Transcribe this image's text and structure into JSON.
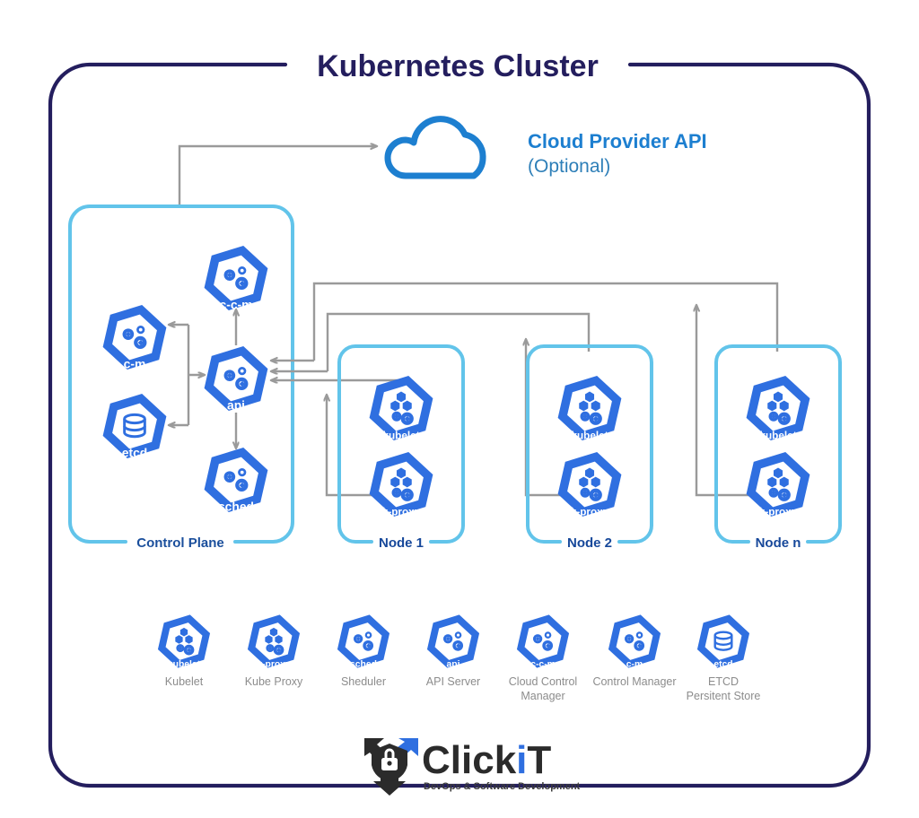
{
  "diagram": {
    "title": "Kubernetes Cluster",
    "colors": {
      "outer_border": "#241e5e",
      "group_border": "#62c4ea",
      "k8s_blue": "#2f6fe0",
      "connector_gray": "#9a9a9a",
      "cloud_blue": "#1d7fd0",
      "legend_text": "#8c8c8c",
      "label_blue": "#17489a",
      "background": "#ffffff"
    }
  },
  "cloud": {
    "icon": "cloud-icon",
    "title": "Cloud Provider API",
    "subtitle": "(Optional)"
  },
  "control_plane": {
    "label": "Control Plane",
    "components": [
      {
        "id": "ccm",
        "caption": "c-c-m",
        "icon": "gears-icon"
      },
      {
        "id": "cm",
        "caption": "c-m",
        "icon": "gears-icon"
      },
      {
        "id": "api",
        "caption": "api",
        "icon": "gears-icon"
      },
      {
        "id": "etcd",
        "caption": "etcd",
        "icon": "database-icon"
      },
      {
        "id": "sched",
        "caption": "sched",
        "icon": "gears-icon"
      }
    ]
  },
  "nodes": [
    {
      "label": "Node 1",
      "components": [
        {
          "id": "kubelet",
          "caption": "kubelet",
          "icon": "cubes-gears-icon"
        },
        {
          "id": "kproxy",
          "caption": "k-proxy",
          "icon": "cubes-gears-icon"
        }
      ]
    },
    {
      "label": "Node 2",
      "components": [
        {
          "id": "kubelet",
          "caption": "kubelet",
          "icon": "cubes-gears-icon"
        },
        {
          "id": "kproxy",
          "caption": "k-proxy",
          "icon": "cubes-gears-icon"
        }
      ]
    },
    {
      "label": "Node n",
      "components": [
        {
          "id": "kubelet",
          "caption": "kubelet",
          "icon": "cubes-gears-icon"
        },
        {
          "id": "kproxy",
          "caption": "k-proxy",
          "icon": "cubes-gears-icon"
        }
      ]
    }
  ],
  "legend": [
    {
      "caption": "kubelet",
      "label_line1": "Kubelet",
      "label_line2": "",
      "icon": "cubes-gears-icon"
    },
    {
      "caption": "k-proxy",
      "label_line1": "Kube Proxy",
      "label_line2": "",
      "icon": "cubes-gears-icon"
    },
    {
      "caption": "sched",
      "label_line1": "Sheduler",
      "label_line2": "",
      "icon": "gears-icon"
    },
    {
      "caption": "api",
      "label_line1": "API Server",
      "label_line2": "",
      "icon": "gears-icon"
    },
    {
      "caption": "c-c-m",
      "label_line1": "Cloud Control",
      "label_line2": "Manager",
      "icon": "gears-icon"
    },
    {
      "caption": "c-m",
      "label_line1": "Control Manager",
      "label_line2": "",
      "icon": "gears-icon"
    },
    {
      "caption": "etcd",
      "label_line1": "ETCD",
      "label_line2": "Persitent Store",
      "icon": "database-icon"
    }
  ],
  "logo": {
    "name_part1": "Click",
    "name_part2": "i",
    "name_part3": "T",
    "tagline": "DevOps & Software Development",
    "icon": "clickit-shield-lock-icon"
  }
}
